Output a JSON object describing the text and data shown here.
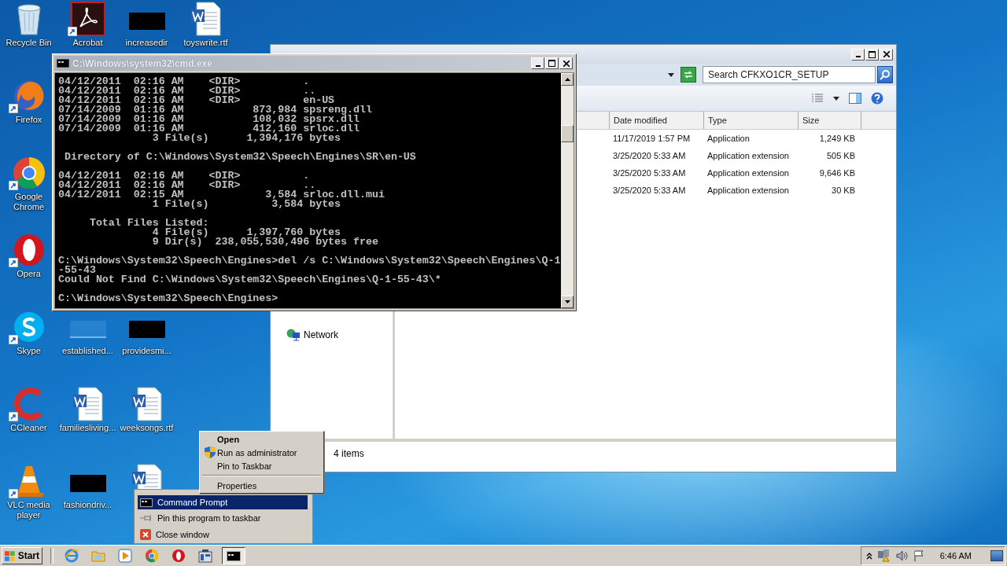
{
  "desktop": {
    "icons": [
      {
        "label": "Recycle Bin",
        "kind": "recycle"
      },
      {
        "label": "Acrobat",
        "kind": "acrobat",
        "shortcut": true
      },
      {
        "label": "increasedir",
        "kind": "redacted"
      },
      {
        "label": "toyswrite.rtf",
        "kind": "word"
      },
      {
        "label": "Firefox",
        "kind": "firefox",
        "shortcut": true
      },
      {
        "label": "Google Chrome",
        "kind": "chrome",
        "shortcut": true
      },
      {
        "label": "Opera",
        "kind": "opera",
        "shortcut": true
      },
      {
        "label": "Skype",
        "kind": "skype",
        "shortcut": true
      },
      {
        "label": "established...",
        "kind": "blank"
      },
      {
        "label": "providesmi...",
        "kind": "redacted"
      },
      {
        "label": "CCleaner",
        "kind": "ccleaner",
        "shortcut": true
      },
      {
        "label": "familiesliving...",
        "kind": "word"
      },
      {
        "label": "weeksongs.rtf",
        "kind": "word"
      },
      {
        "label": "VLC media player",
        "kind": "vlc",
        "shortcut": true
      },
      {
        "label": "fashiondriv...",
        "kind": "redacted"
      },
      {
        "kind": "word"
      }
    ]
  },
  "explorer": {
    "search": {
      "placeholder": "Search CFKXO1CR_SETUP"
    },
    "columns": [
      "Date modified",
      "Type",
      "Size"
    ],
    "rows": [
      {
        "date": "11/17/2019 1:57 PM",
        "type": "Application",
        "size": "1,249 KB"
      },
      {
        "date": "3/25/2020 5:33 AM",
        "type": "Application extension",
        "size": "505 KB"
      },
      {
        "date": "3/25/2020 5:33 AM",
        "type": "Application extension",
        "size": "9,646 KB"
      },
      {
        "date": "3/25/2020 5:33 AM",
        "type": "Application extension",
        "size": "30 KB"
      }
    ],
    "nav": [
      {
        "label": "Network"
      }
    ],
    "status": "4 items"
  },
  "cmd": {
    "title": "C:\\Windows\\system32\\cmd.exe",
    "blocks": [
      [
        "04/12/2011  02:16 AM    <DIR>          .",
        "04/12/2011  02:16 AM    <DIR>          ..",
        "04/12/2011  02:16 AM    <DIR>          en-US",
        "07/14/2009  01:16 AM           873,984 spsreng.dll",
        "07/14/2009  01:16 AM           108,032 spsrx.dll",
        "07/14/2009  01:16 AM           412,160 srloc.dll",
        "               3 File(s)      1,394,176 bytes"
      ],
      [
        " Directory of C:\\Windows\\System32\\Speech\\Engines\\SR\\en-US"
      ],
      [
        "04/12/2011  02:16 AM    <DIR>          .",
        "04/12/2011  02:16 AM    <DIR>          ..",
        "04/12/2011  02:15 AM             3,584 srloc.dll.mui",
        "               1 File(s)          3,584 bytes"
      ],
      [
        "     Total Files Listed:",
        "               4 File(s)      1,397,760 bytes",
        "               9 Dir(s)  238,055,530,496 bytes free"
      ],
      [
        "C:\\Windows\\System32\\Speech\\Engines>del /s C:\\Windows\\System32\\Speech\\Engines\\Q-1",
        "-55-43",
        "Could Not Find C:\\Windows\\System32\\Speech\\Engines\\Q-1-55-43\\*"
      ],
      [
        "C:\\Windows\\System32\\Speech\\Engines>"
      ]
    ]
  },
  "jump_menu": {
    "items": [
      {
        "kind": "item",
        "label": "Open",
        "default": true
      },
      {
        "kind": "shield",
        "label": "Run as administrator",
        "default": false
      },
      {
        "kind": "item",
        "label": "Pin to Taskbar",
        "default": false
      },
      {
        "kind": "separator"
      },
      {
        "kind": "item",
        "label": "Properties",
        "default": false
      }
    ]
  },
  "thumb_menu": {
    "items": [
      {
        "kind": "cmd",
        "label": "Command Prompt",
        "selected": true
      },
      {
        "kind": "pin",
        "label": "Pin this program to taskbar",
        "selected": false
      },
      {
        "kind": "close",
        "label": "Close window",
        "selected": false
      }
    ]
  },
  "taskbar": {
    "start": "Start",
    "apps": [
      {
        "kind": "ie",
        "active": false
      },
      {
        "kind": "folder",
        "active": false
      },
      {
        "kind": "media",
        "active": false
      },
      {
        "kind": "chrome",
        "active": false
      },
      {
        "kind": "opera",
        "active": false
      },
      {
        "kind": "app",
        "active": false
      },
      {
        "kind": "cmd",
        "active": true
      }
    ],
    "clock": "6:46 AM"
  }
}
